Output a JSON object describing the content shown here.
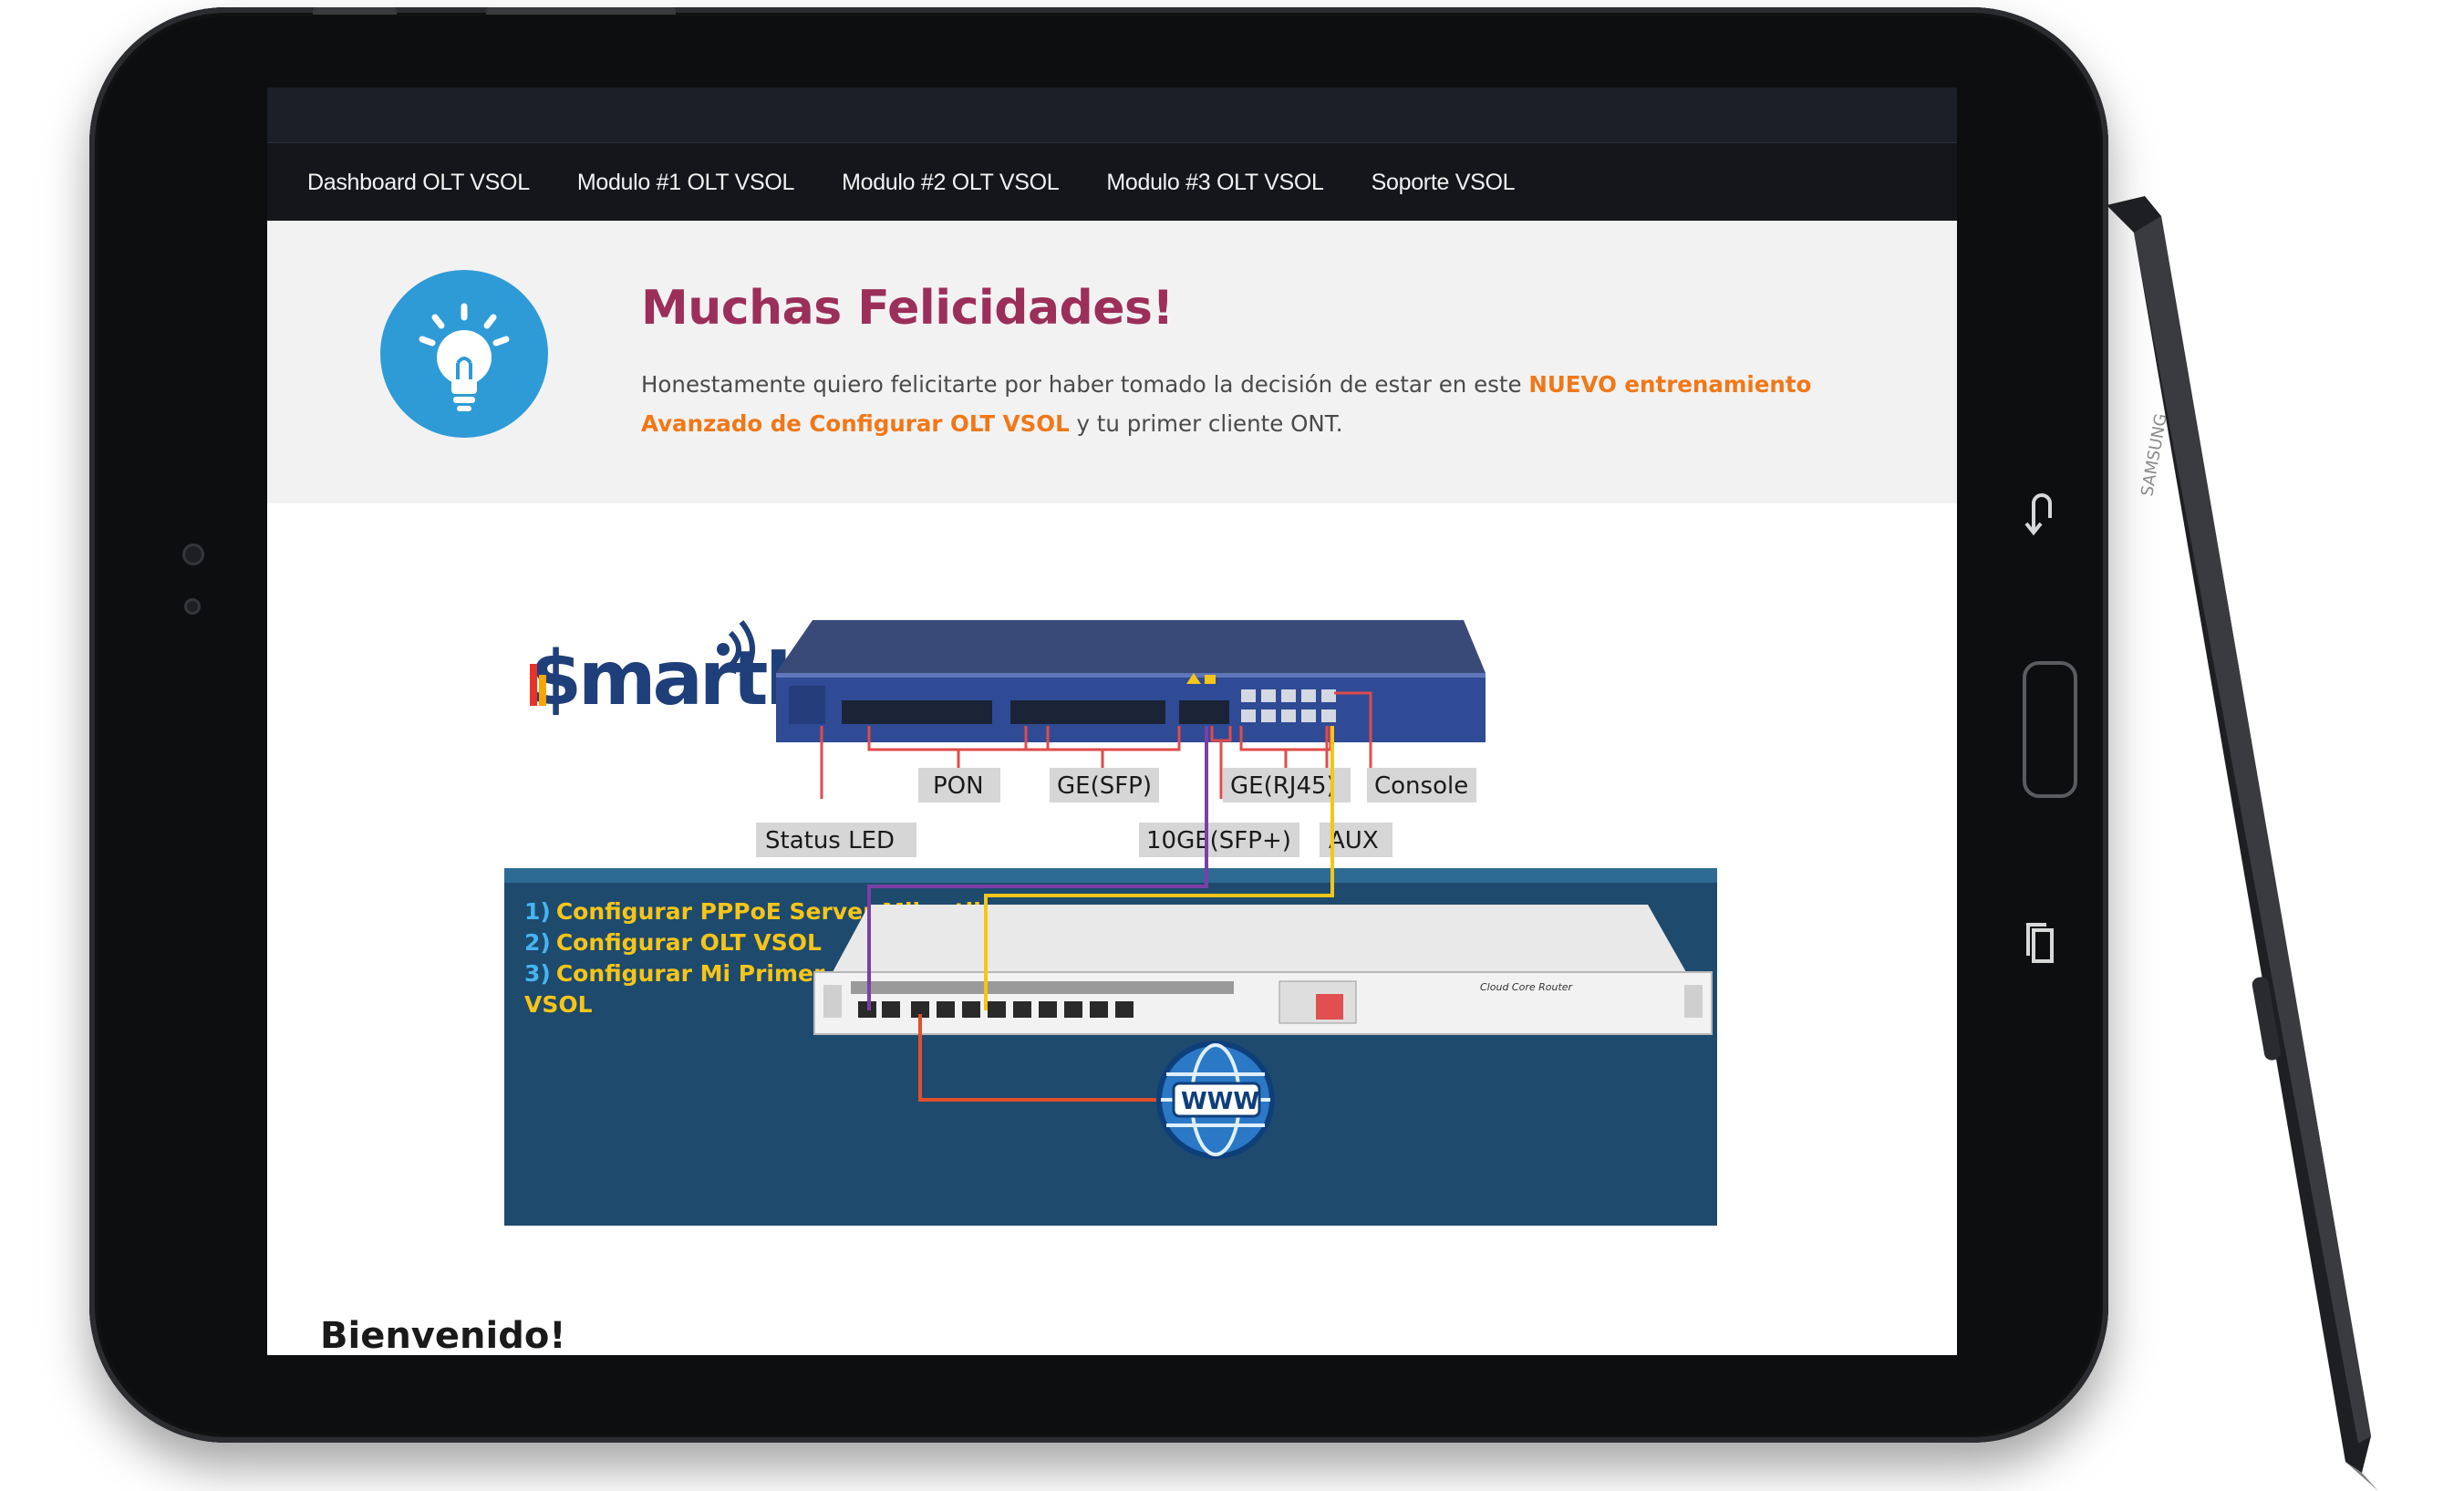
{
  "nav": {
    "items": [
      {
        "label": "Dashboard OLT VSOL"
      },
      {
        "label": "Modulo #1 OLT VSOL"
      },
      {
        "label": "Modulo #2 OLT VSOL"
      },
      {
        "label": "Modulo #3 OLT VSOL"
      },
      {
        "label": "Soporte VSOL"
      }
    ]
  },
  "hero": {
    "title": "Muchas Felicidades!",
    "text_before": "Honestamente quiero felicitarte por haber tomado la decisión de estar en este ",
    "text_highlight": "NUEVO entrenamiento Avanzado de Configurar OLT VSOL",
    "text_after": " y tu primer cliente ONT."
  },
  "diagram": {
    "logo": "SmartISP",
    "labels": {
      "pon": "PON",
      "ge_sfp": "GE(SFP)",
      "ge_rj45": "GE(RJ45)",
      "console": "Console",
      "status_led": "Status LED",
      "tenge": "10GE(SFP+)",
      "aux": "AUX",
      "www": "WWW"
    },
    "steps": [
      {
        "num": "1)",
        "text": "Configurar PPPoE Server Mikrotik."
      },
      {
        "num": "2)",
        "text": "Configurar OLT VSOL"
      },
      {
        "num": "3)",
        "text": "Configurar Mi Primer Cliente ONT"
      },
      {
        "num": "",
        "text": "VSOL"
      }
    ],
    "router_label": "Cloud Core Router"
  },
  "welcome": "Bienvenido!",
  "device": {
    "pen_brand": "SAMSUNG",
    "icons": [
      "back-icon",
      "recent-apps-icon"
    ]
  },
  "colors": {
    "nav_bg": "#14161b",
    "hero_bg": "#f2f2f2",
    "title": "#9b2f5a",
    "highlight": "#f07819",
    "bulb": "#2e9bd6",
    "diagram_panel": "#1e4a6e",
    "step_text": "#f5c518"
  }
}
